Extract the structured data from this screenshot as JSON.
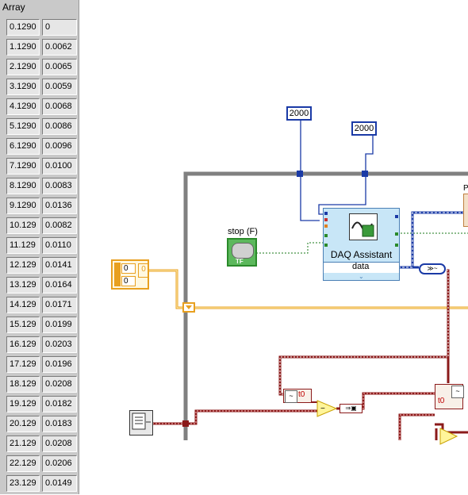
{
  "array_panel": {
    "title": "Array",
    "rows": [
      [
        "0.1290",
        "0"
      ],
      [
        "1.1290",
        "0.0062"
      ],
      [
        "2.1290",
        "0.0065"
      ],
      [
        "3.1290",
        "0.0059"
      ],
      [
        "4.1290",
        "0.0068"
      ],
      [
        "5.1290",
        "0.0086"
      ],
      [
        "6.1290",
        "0.0096"
      ],
      [
        "7.1290",
        "0.0100"
      ],
      [
        "8.1290",
        "0.0083"
      ],
      [
        "9.1290",
        "0.0136"
      ],
      [
        "10.129",
        "0.0082"
      ],
      [
        "11.129",
        "0.0110"
      ],
      [
        "12.129",
        "0.0141"
      ],
      [
        "13.129",
        "0.0164"
      ],
      [
        "14.129",
        "0.0171"
      ],
      [
        "15.129",
        "0.0199"
      ],
      [
        "16.129",
        "0.0203"
      ],
      [
        "17.129",
        "0.0196"
      ],
      [
        "18.129",
        "0.0208"
      ],
      [
        "19.129",
        "0.0182"
      ],
      [
        "20.129",
        "0.0183"
      ],
      [
        "21.129",
        "0.0208"
      ],
      [
        "22.129",
        "0.0206"
      ],
      [
        "23.129",
        "0.0149"
      ]
    ]
  },
  "diagram": {
    "const_a": "2000",
    "const_b": "2000",
    "stop_label": "stop (F)",
    "stop_tf": "TF",
    "daq_title": "DAQ Assistant",
    "daq_data": "data",
    "cluster_values": [
      "0",
      "0"
    ],
    "cluster_index": "0",
    "t0_a": "t0",
    "t0_b": "t0",
    "partial_label": "P",
    "colors": {
      "blue_wire": "#1a3aa6",
      "orange_wire": "#e8a020",
      "dyn_wire": "#8b1a1a",
      "loop": "#808080"
    }
  }
}
